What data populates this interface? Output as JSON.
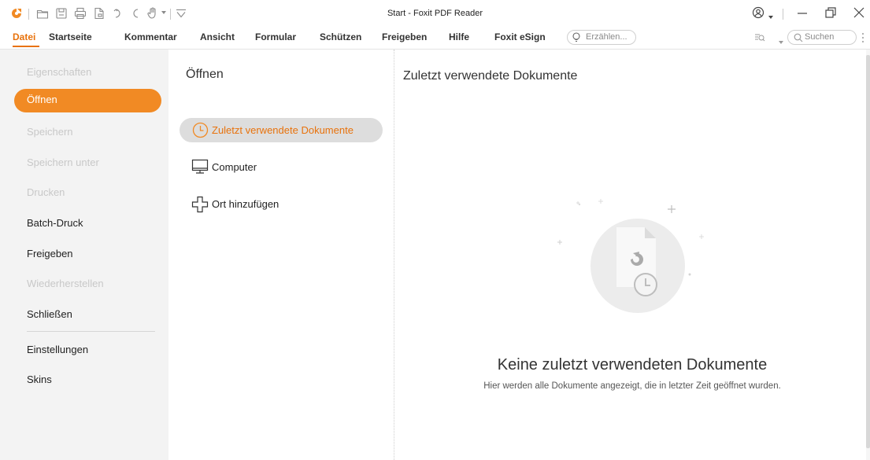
{
  "window": {
    "title": "Start - Foxit PDF Reader"
  },
  "menu": {
    "items": [
      {
        "label": "Datei",
        "active": true
      },
      {
        "label": "Startseite"
      },
      {
        "label": "Kommentar"
      },
      {
        "label": "Ansicht"
      },
      {
        "label": "Formular"
      },
      {
        "label": "Schützen"
      },
      {
        "label": "Freigeben"
      },
      {
        "label": "Hilfe"
      },
      {
        "label": "Foxit eSign"
      }
    ],
    "tell_me_placeholder": "Erzählen...",
    "search_placeholder": "Suchen"
  },
  "file_menu": {
    "items": [
      {
        "label": "Eigenschaften",
        "enabled": false
      },
      {
        "label": "Öffnen",
        "selected": true
      },
      {
        "label": "Speichern",
        "enabled": false
      },
      {
        "label": "Speichern unter",
        "enabled": false
      },
      {
        "label": "Drucken",
        "enabled": false
      },
      {
        "label": "Batch-Druck",
        "enabled": true
      },
      {
        "label": "Freigeben",
        "enabled": true
      },
      {
        "label": "Wiederherstellen",
        "enabled": false
      },
      {
        "label": "Schließen",
        "enabled": true
      },
      {
        "label": "Einstellungen",
        "enabled": true
      },
      {
        "label": "Skins",
        "enabled": true
      }
    ]
  },
  "open_panel": {
    "title": "Öffnen",
    "options": [
      {
        "label": "Zuletzt verwendete Dokumente",
        "icon": "clock-icon",
        "selected": true
      },
      {
        "label": "Computer",
        "icon": "monitor-icon"
      },
      {
        "label": "Ort hinzufügen",
        "icon": "plus-icon"
      }
    ]
  },
  "recent": {
    "title": "Zuletzt verwendete Dokumente",
    "empty_title": "Keine zuletzt verwendeten Dokumente",
    "empty_subtitle": "Hier werden alle Dokumente angezeigt, die in letzter Zeit geöffnet wurden."
  },
  "colors": {
    "accent": "#f18a24",
    "accent_text": "#e8720c",
    "sidebar_bg": "#f3f3f3",
    "selected_option_bg": "#dddddd",
    "disabled_text": "#c8c8c8"
  }
}
